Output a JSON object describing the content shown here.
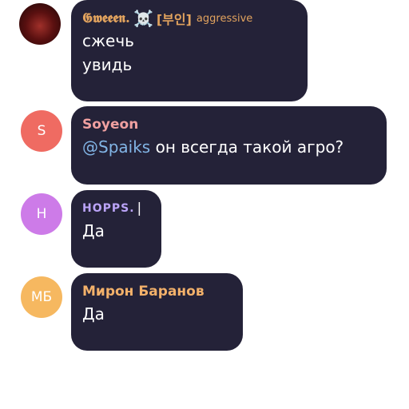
{
  "messages": [
    {
      "avatar_initials": "",
      "author": "𝕲𝖜𝖊𝖊𝖊𝖓.",
      "author_icon": "☠️",
      "author_badge": "[부인]",
      "author_tag": "aggressive",
      "lines": [
        "сжечь",
        "увидь"
      ]
    },
    {
      "avatar_initials": "S",
      "author": "Soyeon",
      "mention": "@Spaiks",
      "text": " он всегда такой агро?"
    },
    {
      "avatar_initials": "H",
      "author": "HOPPS.",
      "author_suffix": "|",
      "text": "Да"
    },
    {
      "avatar_initials": "МБ",
      "author": "Мирон Баранов",
      "text": "Да"
    }
  ],
  "colors": {
    "bubble": "#242238",
    "avatar_soyeon": "#ef6b62",
    "avatar_hopps": "#cd7be8",
    "avatar_miron": "#f6b860"
  }
}
